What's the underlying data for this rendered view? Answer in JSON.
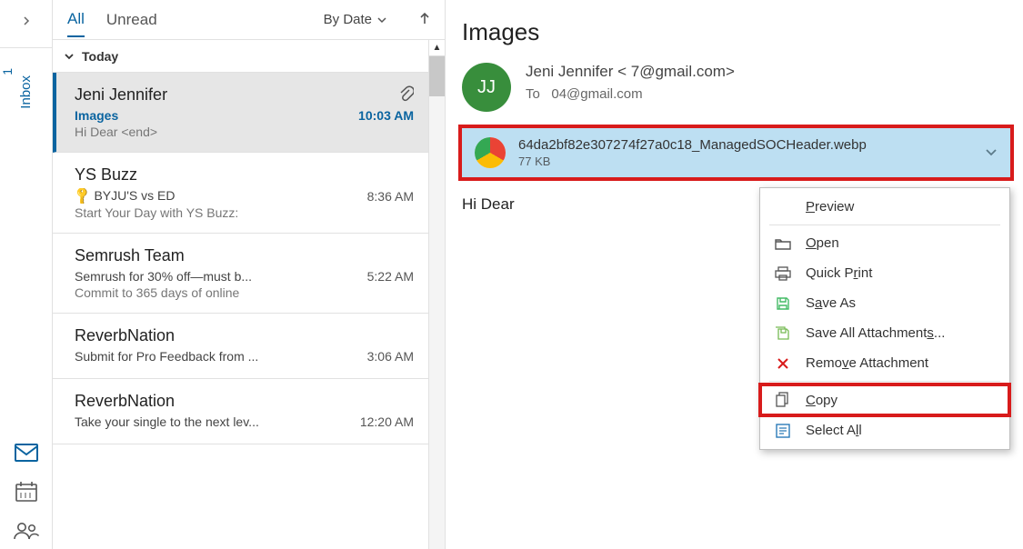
{
  "rail": {
    "inbox_label": "Inbox",
    "inbox_count": "1"
  },
  "list": {
    "tab_all": "All",
    "tab_unread": "Unread",
    "sort_label": "By Date",
    "group_today": "Today"
  },
  "messages": [
    {
      "sender": "Jeni Jennifer",
      "subject": "Images",
      "time": "10:03 AM",
      "preview": "Hi Dear <end>",
      "selected": true,
      "has_attachment": true
    },
    {
      "sender": "YS Buzz",
      "subject": "BYJU'S vs ED",
      "time": "8:36 AM",
      "preview": "Start Your Day with YS Buzz:",
      "key_icon": true
    },
    {
      "sender": "Semrush Team",
      "subject": "Semrush for 30% off—must b...",
      "time": "5:22 AM",
      "preview": "Commit to 365 days of online"
    },
    {
      "sender": "ReverbNation",
      "subject": "Submit for Pro Feedback from ...",
      "time": "3:06 AM",
      "preview": ""
    },
    {
      "sender": "ReverbNation",
      "subject": "Take your single to the next lev...",
      "time": "12:20 AM",
      "preview": ""
    }
  ],
  "reading": {
    "subject": "Images",
    "avatar_initials": "JJ",
    "from_display": "Jeni Jennifer <                         7@gmail.com>",
    "to_label": "To",
    "to_value": "             04@gmail.com",
    "attachment": {
      "name": "64da2bf82e307274f27a0c18_ManagedSOCHeader.webp",
      "size": "77 KB"
    },
    "body": "Hi Dear"
  },
  "context_menu": {
    "preview": "Preview",
    "open": "Open",
    "quick_print": "Quick Print",
    "save_as": "Save As",
    "save_all": "Save All Attachments...",
    "remove": "Remove Attachment",
    "copy": "Copy",
    "select_all": "Select All"
  }
}
